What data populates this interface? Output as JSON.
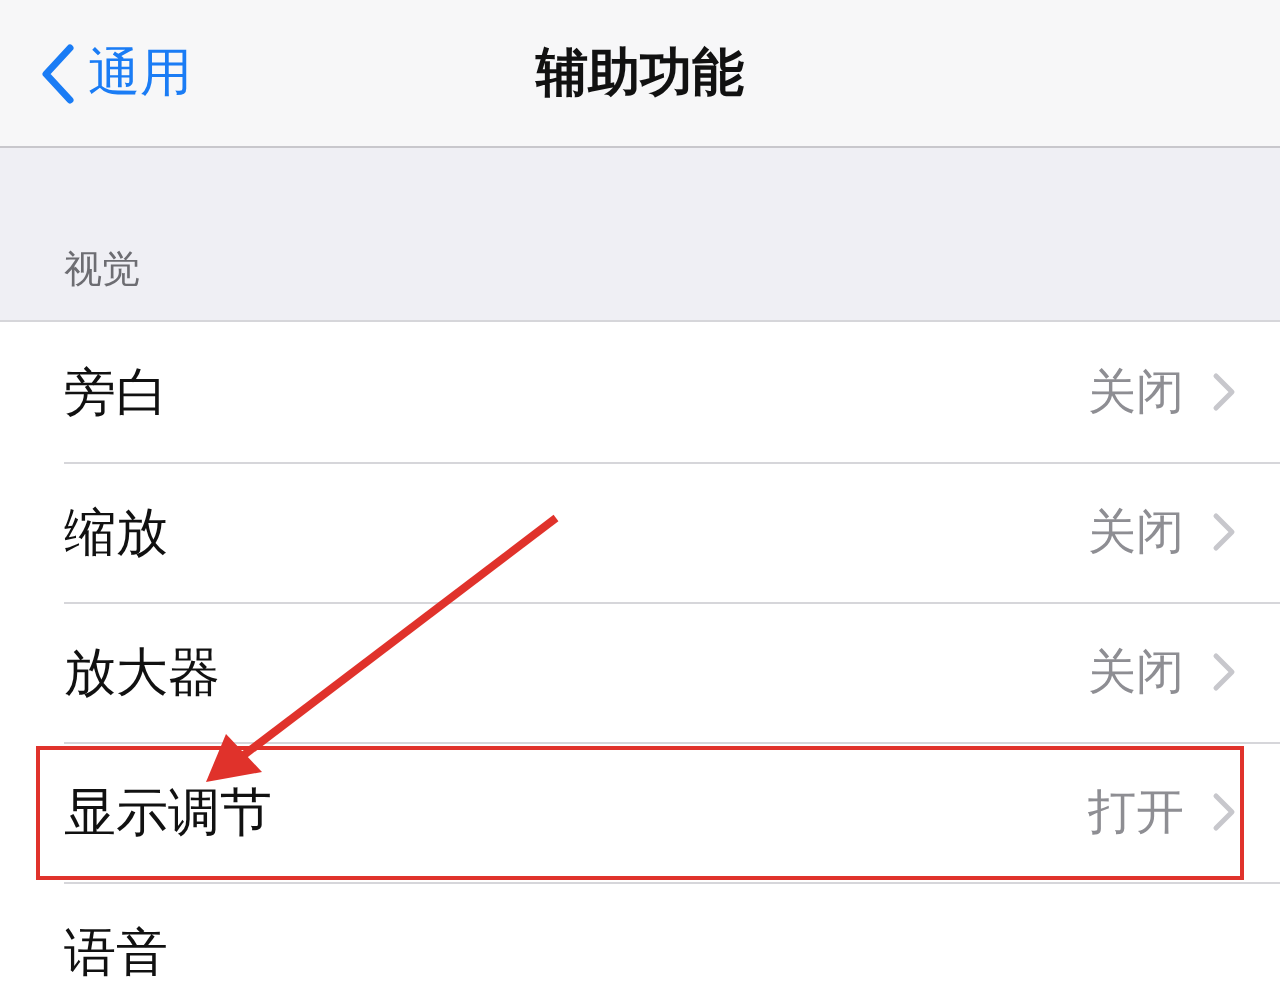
{
  "nav_bar": {
    "back_label": "通用",
    "title": "辅助功能"
  },
  "section": {
    "header": "视觉",
    "rows": [
      {
        "label": "旁白",
        "value": "关闭",
        "highlighted": false
      },
      {
        "label": "缩放",
        "value": "关闭",
        "highlighted": false
      },
      {
        "label": "放大器",
        "value": "关闭",
        "highlighted": false
      },
      {
        "label": "显示调节",
        "value": "打开",
        "highlighted": true
      },
      {
        "label": "语音",
        "highlighted": false
      }
    ]
  }
}
